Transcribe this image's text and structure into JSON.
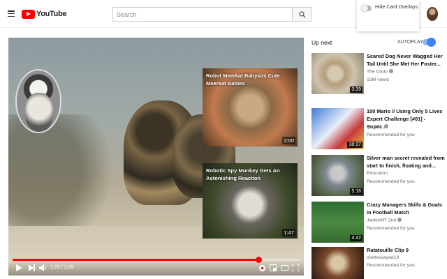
{
  "header": {
    "logo_text": "YouTube",
    "search_placeholder": "Search"
  },
  "popup": {
    "label": "Hide Card Overlays",
    "enabled": false
  },
  "player": {
    "cards": [
      {
        "title": "Robot Meerkat Babysits Cute Meerkat Babies",
        "duration": "2:00"
      },
      {
        "title": "Robotic Spy Monkey Gets An Astonishing Reaction",
        "duration": "1:47"
      }
    ],
    "current_time": "1:25",
    "total_time": "1:39",
    "progress_fraction": 0.856
  },
  "sidebar": {
    "heading": "Up next",
    "autoplay_label": "AUTOPLAY",
    "autoplay_on": true,
    "items": [
      {
        "title": "Scared Dog Never Wagged Her Tail Until She Met Her Foster...",
        "channel": "The Dodo",
        "verified": true,
        "meta": "15M views",
        "duration": "3:39"
      },
      {
        "title": "100 Mario // Using Only 5 Lives Expert Challenge [#01] - Super...",
        "channel": "ryukahr",
        "verified": true,
        "meta": "Recommended for you",
        "duration": "38:37"
      },
      {
        "title": "Silver man secret revealed from start to finish, floating and...",
        "channel": "Education",
        "verified": false,
        "meta": "Recommended for you",
        "duration": "5:16"
      },
      {
        "title": "Crazy Managers Skills & Goals in Football Match",
        "channel": "JackieMT 2nd",
        "verified": true,
        "meta": "Recommended for you",
        "duration": "4:42"
      },
      {
        "title": "Ratatouille Clip 9",
        "channel": "methesiayed19",
        "verified": false,
        "meta": "Recommended for you",
        "duration": ""
      }
    ]
  },
  "colors": {
    "accent_red": "#ff0000",
    "autoplay_blue": "#3e82f7"
  }
}
